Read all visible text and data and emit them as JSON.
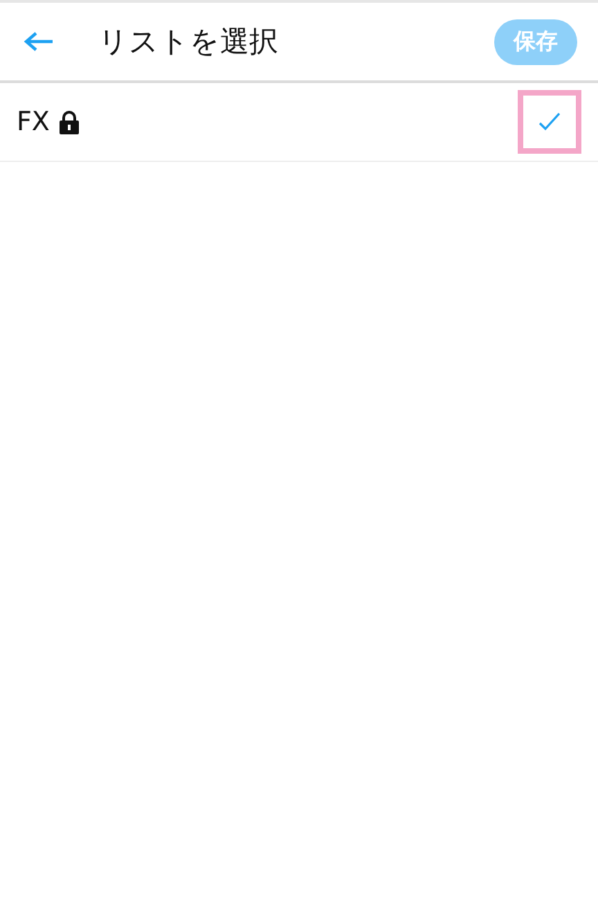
{
  "header": {
    "title": "リストを選択",
    "save_button": {
      "label": "保存",
      "disabled": true
    }
  },
  "lists": [
    {
      "name": "FX",
      "private": true,
      "checked": true,
      "highlighted": true
    }
  ]
}
